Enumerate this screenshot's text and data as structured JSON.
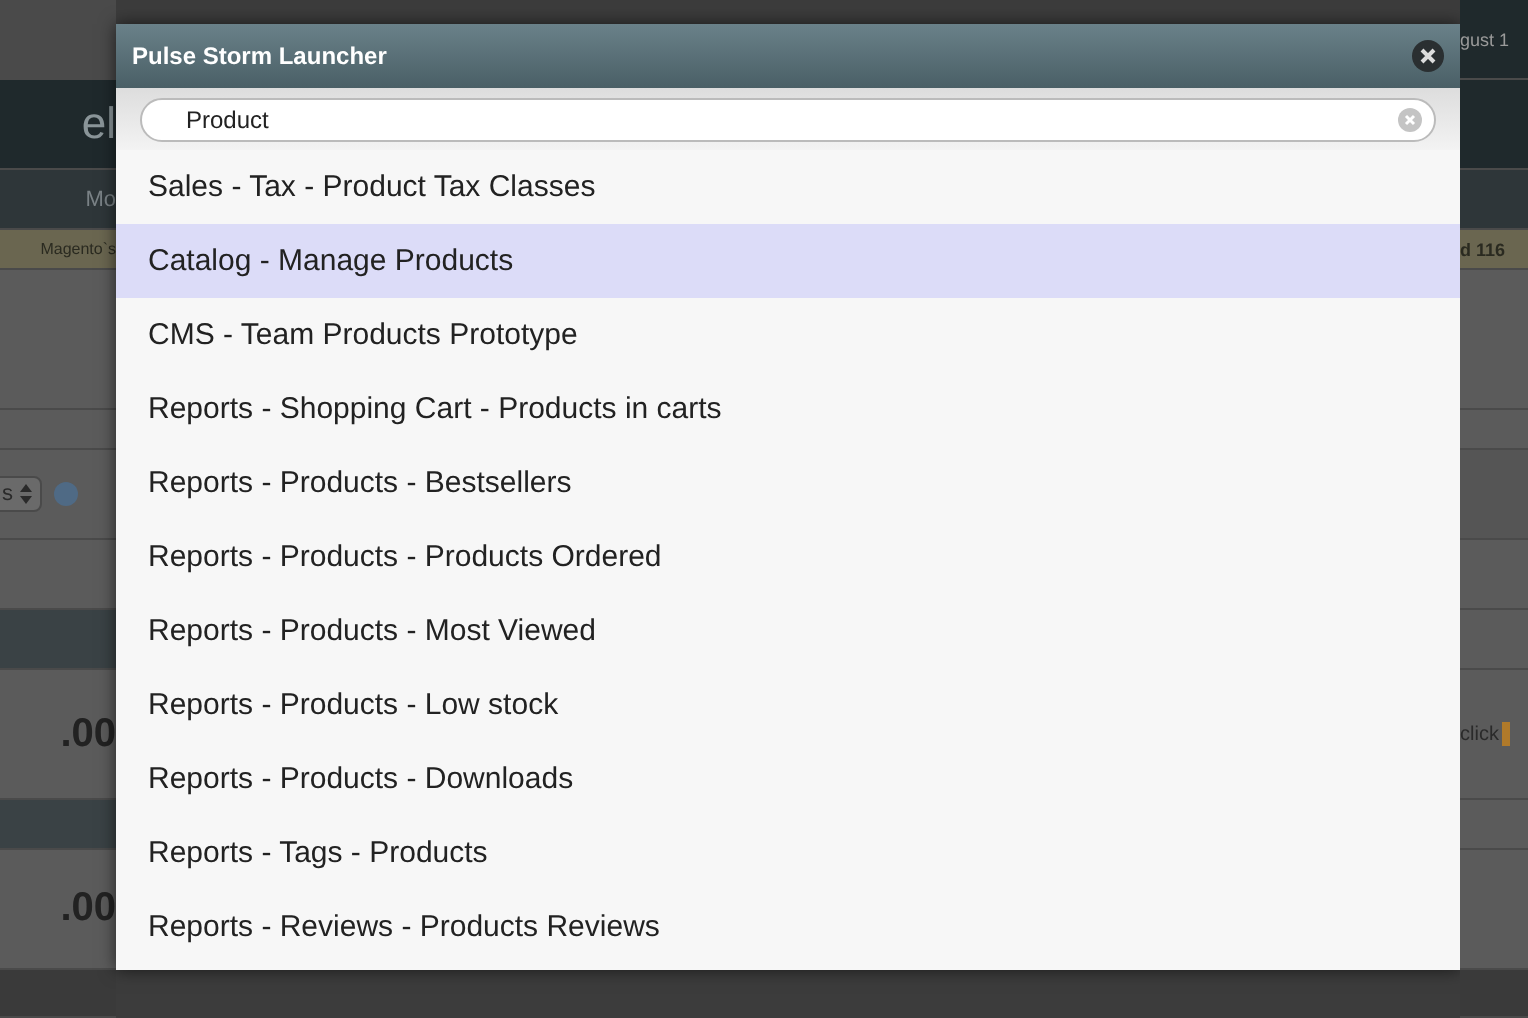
{
  "background": {
    "left": {
      "header_title": "el",
      "tab": "Mo",
      "notice": "Magento`s",
      "select_value": "s",
      "amounts": [
        ".00",
        ".00"
      ]
    },
    "right": {
      "header_date": "gust 1",
      "notice": "d 116",
      "link_text": "click"
    }
  },
  "launcher": {
    "title": "Pulse Storm Launcher",
    "search": {
      "value": "Product"
    },
    "results": [
      {
        "label": "Sales - Tax - Product Tax Classes",
        "selected": false
      },
      {
        "label": "Catalog - Manage Products",
        "selected": true
      },
      {
        "label": "CMS - Team Products Prototype",
        "selected": false
      },
      {
        "label": "Reports - Shopping Cart - Products in carts",
        "selected": false
      },
      {
        "label": "Reports - Products - Bestsellers",
        "selected": false
      },
      {
        "label": "Reports - Products - Products Ordered",
        "selected": false
      },
      {
        "label": "Reports - Products - Most Viewed",
        "selected": false
      },
      {
        "label": "Reports - Products - Low stock",
        "selected": false
      },
      {
        "label": "Reports - Products - Downloads",
        "selected": false
      },
      {
        "label": "Reports - Tags - Products",
        "selected": false
      },
      {
        "label": "Reports - Reviews - Products Reviews",
        "selected": false
      }
    ]
  }
}
